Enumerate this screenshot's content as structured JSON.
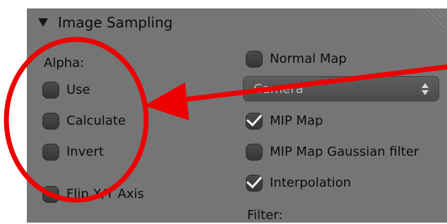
{
  "panel": {
    "title": "Image Sampling",
    "accent_color": "#757575"
  },
  "left_column": {
    "alpha_label": "Alpha:",
    "use": {
      "label": "Use",
      "checked": false
    },
    "calculate": {
      "label": "Calculate",
      "checked": false
    },
    "invert": {
      "label": "Invert",
      "checked": false
    },
    "flip_xy": {
      "label": "Flip X/Y Axis",
      "checked": false
    }
  },
  "right_column": {
    "normal_map": {
      "label": "Normal Map",
      "checked": false
    },
    "projection_select": {
      "value": "Camera"
    },
    "mip_map": {
      "label": "MIP Map",
      "checked": true
    },
    "mip_map_gaussian": {
      "label": "MIP Map Gaussian filter",
      "checked": false
    },
    "interpolation": {
      "label": "Interpolation",
      "checked": true
    },
    "filter_label": "Filter:"
  },
  "annotation": {
    "color": "#ee0000"
  }
}
